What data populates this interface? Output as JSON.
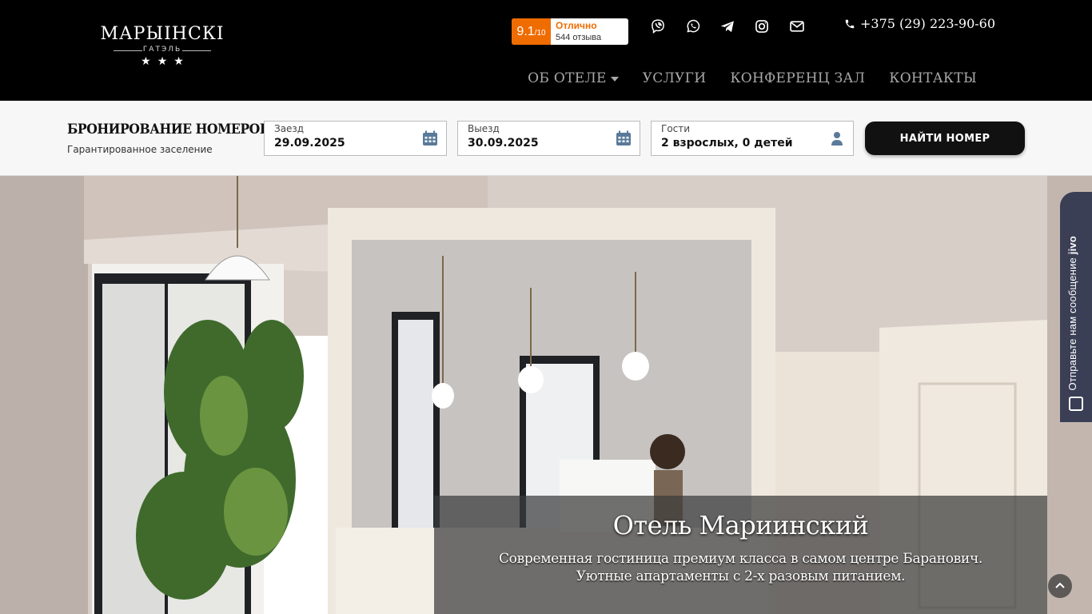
{
  "header": {
    "logo": {
      "name": "МАРЫІНСКІ",
      "sub": "ГАТЭЛЬ",
      "stars": "★★★"
    },
    "rating": {
      "score": "9.1",
      "scale": "/10",
      "label": "Отлично",
      "count": "544 отзыва"
    },
    "social": [
      "viber-icon",
      "whatsapp-icon",
      "telegram-icon",
      "instagram-icon",
      "mail-icon"
    ],
    "phone": "+375 (29) 223-90-60",
    "nav": [
      "ОБ ОТЕЛЕ",
      "УСЛУГИ",
      "КОНФЕРЕНЦ ЗАЛ",
      "КОНТАКТЫ"
    ]
  },
  "booking": {
    "title": "БРОНИРОВАНИЕ НОМЕРОВ",
    "subtitle": "Гарантированное заселение",
    "checkin": {
      "label": "Заезд",
      "value": "29.09.2025"
    },
    "checkout": {
      "label": "Выезд",
      "value": "30.09.2025"
    },
    "guests": {
      "label": "Гости",
      "value": "2 взрослых, 0 детей"
    },
    "button": "НАЙТИ НОМЕР"
  },
  "hero": {
    "title": "Отель Мариинский",
    "line1": "Современная гостиница премиум класса в самом центре Баранович.",
    "line2": "Уютные апартаменты с 2-х разовым питанием."
  },
  "chat": {
    "label": "Отправьте нам сообщение",
    "brand": "jivo"
  },
  "colors": {
    "accent": "#ef6c00",
    "header_bg": "#000000",
    "booking_bg": "#f7f7f7",
    "chat_bg": "#3a3f55"
  }
}
